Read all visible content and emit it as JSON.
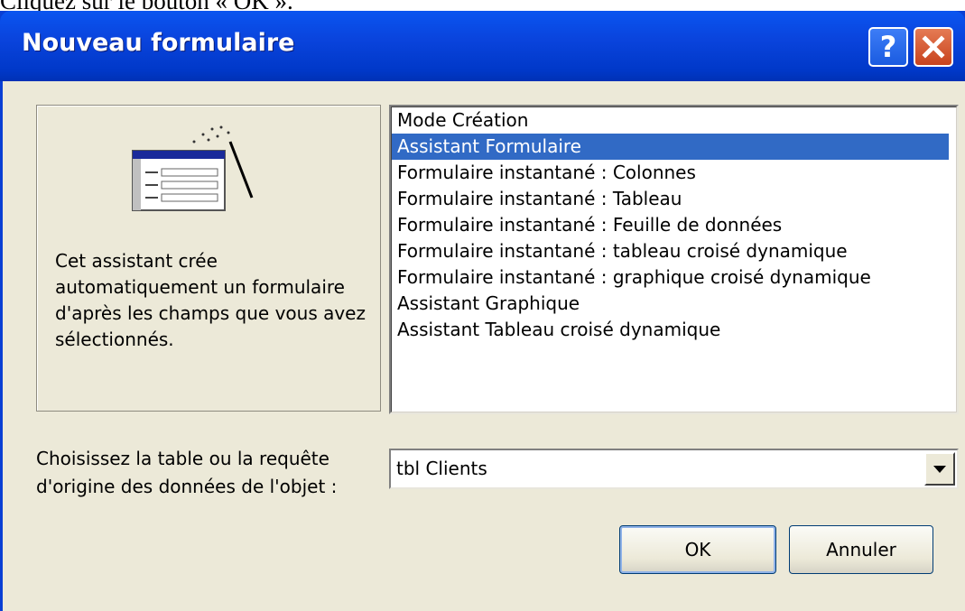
{
  "caption": "Cliquez sur le bouton « OK ».",
  "dialog": {
    "title": "Nouveau formulaire",
    "help_icon": "question-mark-icon",
    "close_icon": "close-x-icon"
  },
  "preview": {
    "icon": "form-wizard-icon",
    "description": "Cet assistant crée automatiquement un formulaire d'après les champs que vous avez sélectionnés."
  },
  "list": {
    "items": [
      "Mode Création",
      "Assistant Formulaire",
      "Formulaire instantané : Colonnes",
      "Formulaire instantané : Tableau",
      "Formulaire instantané : Feuille de données",
      "Formulaire instantané : tableau croisé dynamique",
      "Formulaire instantané : graphique croisé dynamique",
      "Assistant Graphique",
      "Assistant Tableau croisé dynamique"
    ],
    "selected_index": 1
  },
  "source": {
    "label": "Choisissez la table ou la requête d'origine des données de l'objet :",
    "value": "tbl Clients"
  },
  "buttons": {
    "ok": "OK",
    "cancel": "Annuler"
  },
  "colors": {
    "titlebar": "#0a44dd",
    "selection": "#316ac5",
    "face": "#ece9d8",
    "close_button": "#c8431e"
  }
}
